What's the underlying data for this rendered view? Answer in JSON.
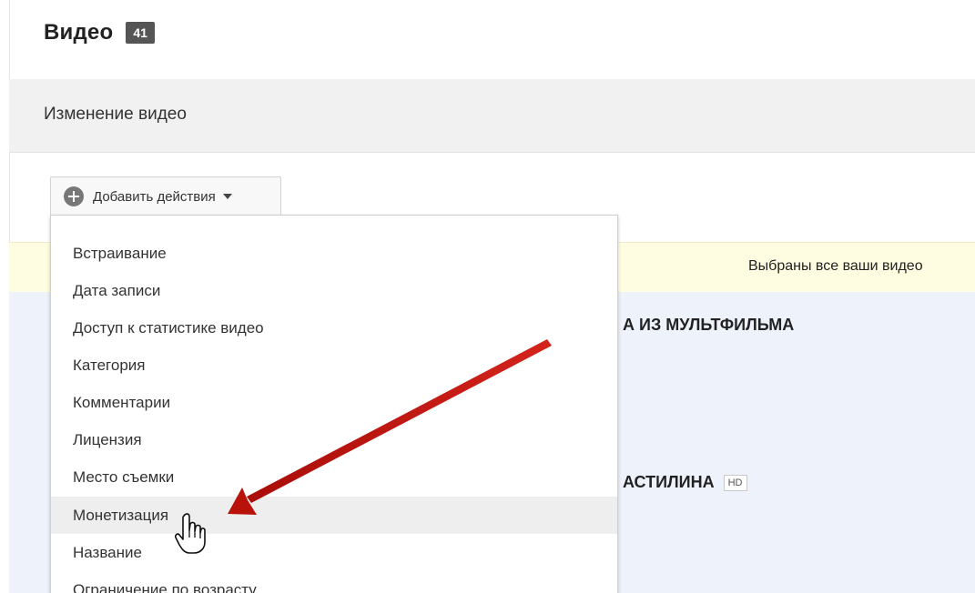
{
  "header": {
    "title": "Видео",
    "count": "41"
  },
  "edit_bar": {
    "title": "Изменение видео"
  },
  "actions": {
    "add_label": "Добавить действия",
    "icon": "plus-circle-icon",
    "caret": "caret-down-icon"
  },
  "notice": {
    "text": "Выбраны все ваши видео"
  },
  "videos": [
    {
      "title": "А ИЗ МУЛЬТФИЛЬМА"
    },
    {
      "title": "АСТИЛИНА",
      "badge": "HD"
    }
  ],
  "menu": {
    "items": [
      {
        "label": "Встраивание"
      },
      {
        "label": "Дата записи"
      },
      {
        "label": "Доступ к статистике видео"
      },
      {
        "label": "Категория"
      },
      {
        "label": "Комментарии"
      },
      {
        "label": "Лицензия"
      },
      {
        "label": "Место съемки"
      },
      {
        "label": "Монетизация",
        "hovered": true
      },
      {
        "label": "Название"
      },
      {
        "label": "Ограничение по возрасту"
      }
    ]
  },
  "annotation": {
    "arrow_color": "#c0120c",
    "cursor": "hand-pointer-icon"
  },
  "colors": {
    "badge_bg": "#555555",
    "edit_bar_bg": "#f1f1f1",
    "notice_bg": "#fffde1",
    "list_bg": "#eef2fb",
    "menu_hover_bg": "#eeeeee"
  }
}
